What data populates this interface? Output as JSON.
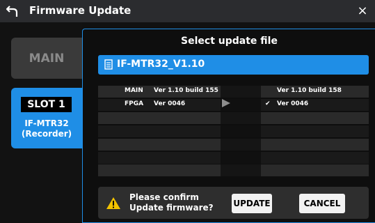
{
  "titlebar": {
    "title": "Firmware Update",
    "back_icon": "back-arrow-icon",
    "close_icon": "close-icon",
    "close_glyph": "×"
  },
  "left_panel": {
    "main_label": "MAIN",
    "slot_label": "SLOT 1",
    "slot_device_line1": "IF-MTR32",
    "slot_device_line2": "(Recorder)"
  },
  "dialog": {
    "title": "Select update file",
    "file_name": "IF-MTR32_V1.10",
    "file_icon": "document-icon",
    "rows": [
      {
        "label": "MAIN",
        "current": "Ver  1.10 build 155",
        "check": "",
        "new": "Ver 1.10 build 158"
      },
      {
        "label": "FPGA",
        "current": "Ver 0046",
        "check": "✔",
        "new": "Ver 0046"
      }
    ],
    "arrow_icon": "play-arrow-icon",
    "confirm_line1": "Please confirm",
    "confirm_line2": "Update firmware?",
    "warning_icon": "warning-icon",
    "update_label": "UPDATE",
    "cancel_label": "CANCEL"
  },
  "colors": {
    "accent": "#1f8ee6",
    "titlebar": "#2b2c2f",
    "warning": "#f2c200"
  }
}
